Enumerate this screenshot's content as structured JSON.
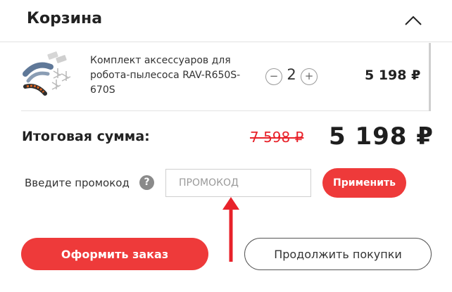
{
  "cart": {
    "title": "Корзина",
    "collapse_icon": "chevron-up-icon"
  },
  "item": {
    "name": "Комплект аксессуаров для робота-пылесоса RAV-R650S-670S",
    "quantity": "2",
    "minus_label": "−",
    "plus_label": "+",
    "price": "5 198 ₽",
    "image_icon": "product-accessories-image"
  },
  "totals": {
    "label": "Итоговая сумма:",
    "old_price": "7 598 ₽",
    "new_price": "5 198 ₽"
  },
  "promo": {
    "label": "Введите промокод",
    "help_symbol": "?",
    "placeholder": "ПРОМОКОД",
    "apply_label": "Применить"
  },
  "actions": {
    "checkout_label": "Оформить заказ",
    "continue_label": "Продолжить покупки"
  },
  "colors": {
    "accent": "#ee3a3a",
    "old_price": "#e8222a",
    "annotation_arrow": "#e8222a"
  }
}
